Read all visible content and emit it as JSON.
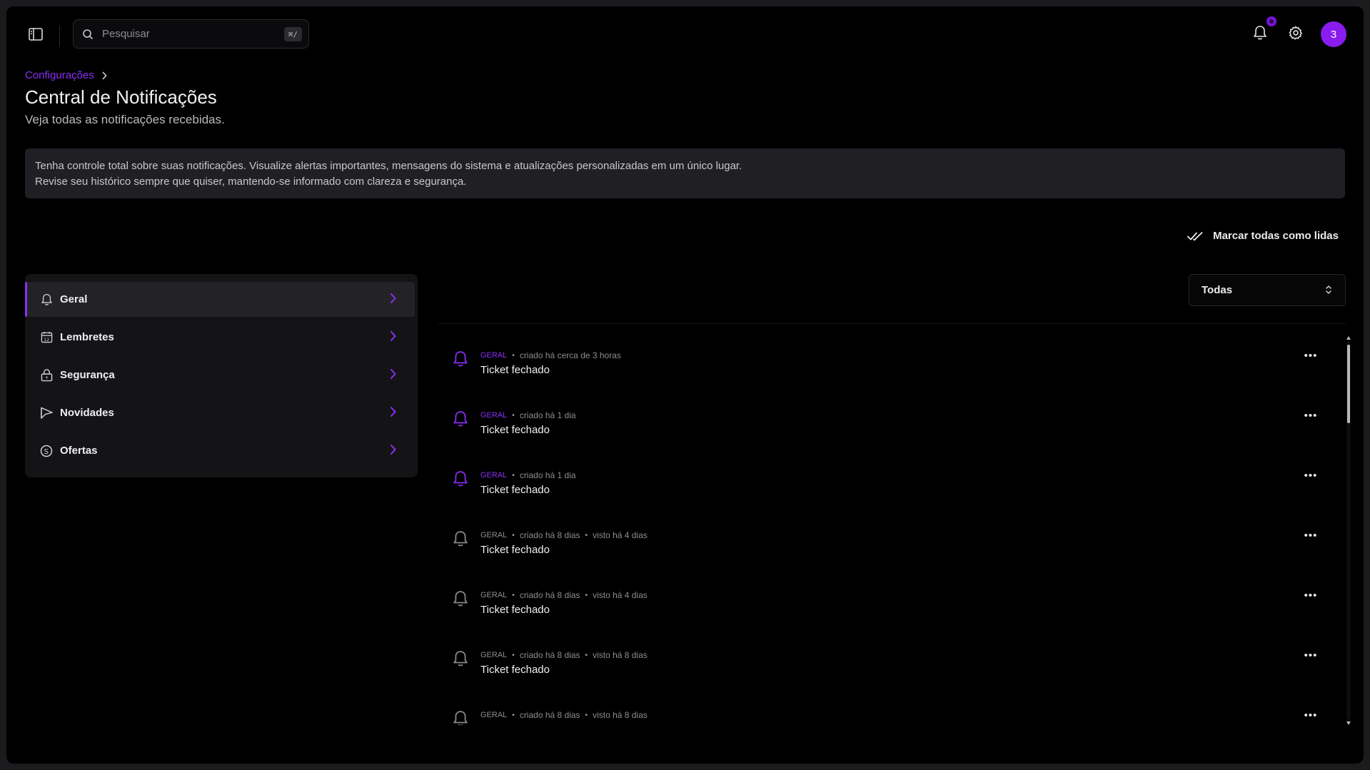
{
  "topbar": {
    "search_placeholder": "Pesquisar",
    "search_shortcut": "⌘/",
    "avatar_initial": "3"
  },
  "breadcrumb": {
    "parent": "Configurações"
  },
  "header": {
    "title": "Central de Notificações",
    "subtitle": "Veja todas as notificações recebidas."
  },
  "info": {
    "line1": "Tenha controle total sobre suas notificações. Visualize alertas importantes, mensagens do sistema e atualizações personalizadas em um único lugar.",
    "line2": "Revise seu histórico sempre que quiser, mantendo-se informado com clareza e segurança."
  },
  "actions": {
    "mark_all_read": "Marcar todas como lidas"
  },
  "filter": {
    "selected": "Todas"
  },
  "categories": [
    {
      "label": "Geral",
      "icon": "bell-icon",
      "active": true
    },
    {
      "label": "Lembretes",
      "icon": "calendar-icon",
      "active": false
    },
    {
      "label": "Segurança",
      "icon": "lock-icon",
      "active": false
    },
    {
      "label": "Novidades",
      "icon": "megaphone-icon",
      "active": false
    },
    {
      "label": "Ofertas",
      "icon": "coin-icon",
      "active": false
    }
  ],
  "notifications": [
    {
      "tag": "GERAL",
      "created": "criado há cerca de 3 horas",
      "seen": "",
      "title": "Ticket fechado",
      "unread": true
    },
    {
      "tag": "GERAL",
      "created": "criado há 1 dia",
      "seen": "",
      "title": "Ticket fechado",
      "unread": true
    },
    {
      "tag": "GERAL",
      "created": "criado há 1 dia",
      "seen": "",
      "title": "Ticket fechado",
      "unread": true
    },
    {
      "tag": "GERAL",
      "created": "criado há 8 dias",
      "seen": "visto há 4 dias",
      "title": "Ticket fechado",
      "unread": false
    },
    {
      "tag": "GERAL",
      "created": "criado há 8 dias",
      "seen": "visto há 4 dias",
      "title": "Ticket fechado",
      "unread": false
    },
    {
      "tag": "GERAL",
      "created": "criado há 8 dias",
      "seen": "visto há 8 dias",
      "title": "Ticket fechado",
      "unread": false
    },
    {
      "tag": "GERAL",
      "created": "criado há 8 dias",
      "seen": "visto há 8 dias",
      "title": "",
      "unread": false
    }
  ],
  "colors": {
    "accent": "#8b2ff5",
    "background": "#000000",
    "panel": "#141417",
    "muted_text": "#8d8d95"
  }
}
